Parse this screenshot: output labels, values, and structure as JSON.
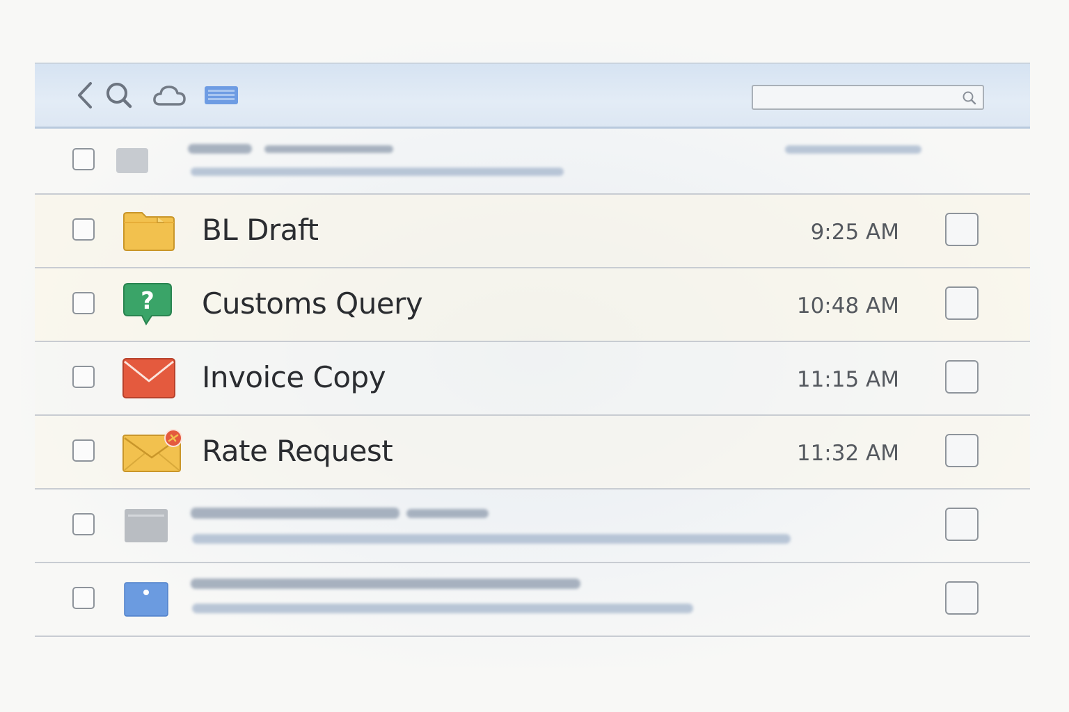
{
  "toolbar": {
    "icons": [
      "back-icon",
      "search-icon",
      "cloud-icon",
      "keyboard-icon"
    ],
    "search": {
      "value": "",
      "placeholder": ""
    }
  },
  "messages": [
    {
      "subject": "BL Draft",
      "time": "9:25 AM",
      "icon": "folder-icon",
      "color": "#f2c14e"
    },
    {
      "subject": "Customs Query",
      "time": "10:48 AM",
      "icon": "question-bubble-icon",
      "color": "#3aa468"
    },
    {
      "subject": "Invoice Copy",
      "time": "11:15 AM",
      "icon": "envelope-icon",
      "color": "#e45a3e"
    },
    {
      "subject": "Rate Request",
      "time": "11:32 AM",
      "icon": "envelope-flagged-icon",
      "color": "#f2c14e"
    }
  ],
  "placeholder_rows": [
    {
      "icon": "gray-thumbnail-icon",
      "color": "#c7cbd0"
    },
    {
      "icon": "gray-window-icon",
      "color": "#b9bdc2"
    },
    {
      "icon": "blue-window-icon",
      "color": "#6b9be0"
    }
  ]
}
